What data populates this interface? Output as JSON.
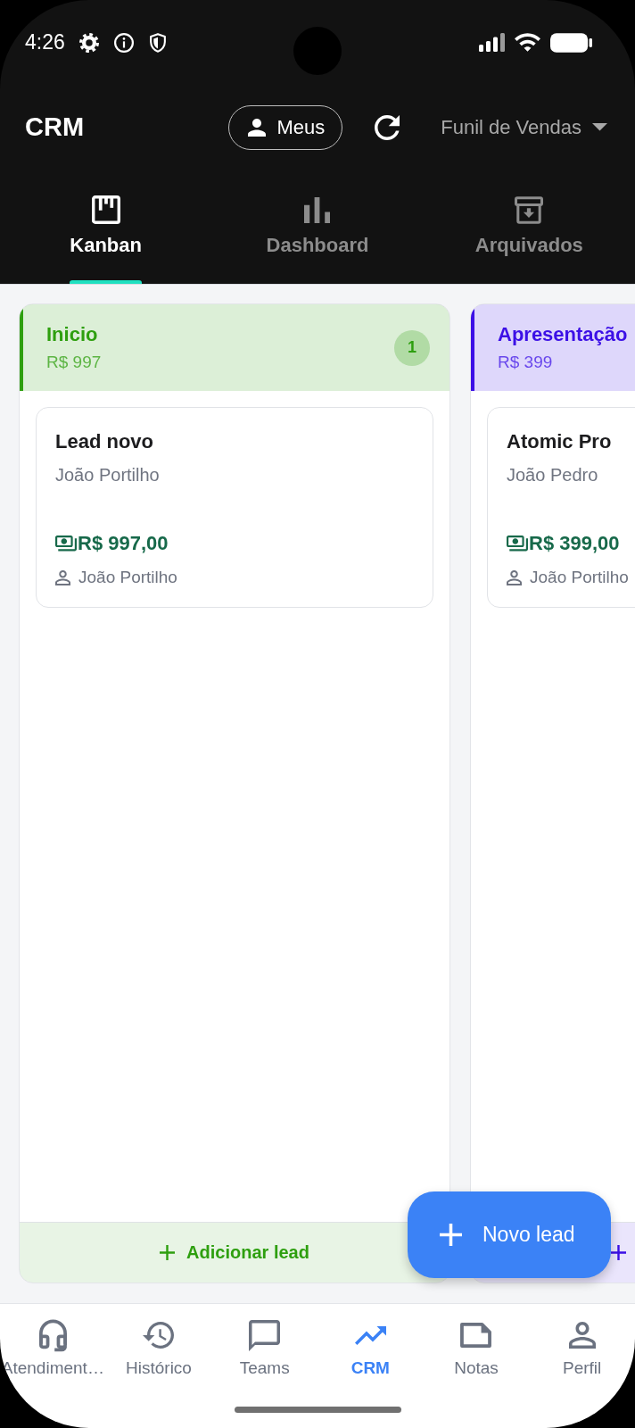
{
  "status_bar": {
    "time": "4:26"
  },
  "app_bar": {
    "title": "CRM",
    "filter_button": {
      "label": "Meus"
    },
    "pipeline_dropdown": {
      "value": "Funil de Vendas"
    }
  },
  "tabs": [
    {
      "label": "Kanban",
      "selected": true
    },
    {
      "label": "Dashboard",
      "selected": false
    },
    {
      "label": "Arquivados",
      "selected": false
    }
  ],
  "columns": [
    {
      "title": "Inicio",
      "total": "R$ 997",
      "count": "1",
      "color": "#2e9f0f",
      "cards": [
        {
          "title": "Lead novo",
          "contact": "João Portilho",
          "value": "R$ 997,00",
          "owner": "João Portilho"
        }
      ],
      "add_label": "Adicionar lead"
    },
    {
      "title": "Apresentação",
      "total": "R$ 399",
      "color": "#3c10e6",
      "cards": [
        {
          "title": "Atomic Pro",
          "contact": "João Pedro",
          "value": "R$ 399,00",
          "owner": "João Portilho"
        }
      ]
    }
  ],
  "fab": {
    "label": "Novo lead"
  },
  "bottom_nav": [
    {
      "label": "Atendiment…",
      "selected": false
    },
    {
      "label": "Histórico",
      "selected": false
    },
    {
      "label": "Teams",
      "selected": false
    },
    {
      "label": "CRM",
      "selected": true
    },
    {
      "label": "Notas",
      "selected": false
    },
    {
      "label": "Perfil",
      "selected": false
    }
  ]
}
